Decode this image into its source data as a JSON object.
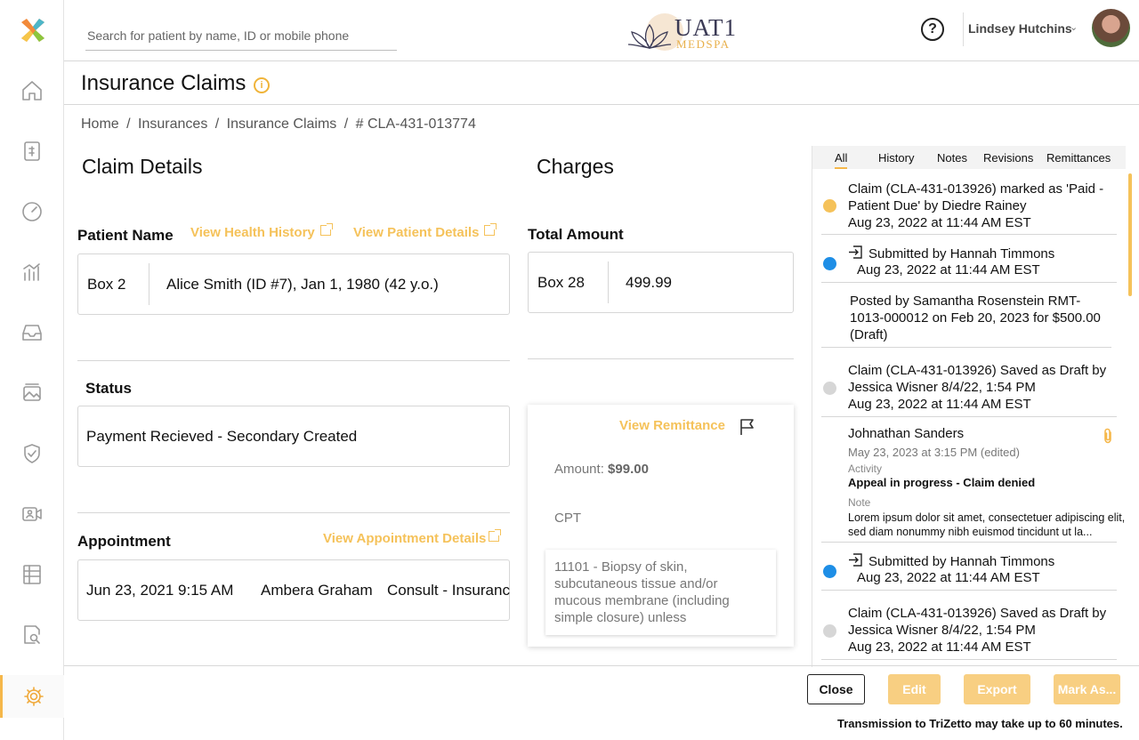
{
  "topbar": {
    "search_placeholder": "Search for patient by name, ID or mobile phone",
    "brand_name": "UAT1",
    "brand_sub": "MEDSPA",
    "help": "?",
    "user_name": "Lindsey Hutchins",
    "user_chevron": "⌄"
  },
  "sidebar": {
    "items": [
      "home-icon",
      "invoice-icon",
      "dashboard-gauge-icon",
      "analytics-icon",
      "inbox-icon",
      "gallery-icon",
      "shield-icon",
      "video-icon",
      "list-icon",
      "search-document-icon",
      "settings-icon"
    ],
    "active": "settings-icon"
  },
  "header": {
    "title": "Insurance Claims",
    "breadcrumb": [
      "Home",
      "/",
      "Insurances",
      "/",
      "Insurance Claims",
      "/",
      "# CLA-431-013774"
    ]
  },
  "claim": {
    "section_title": "Claim Details",
    "patient_label": "Patient Name",
    "view_health_history": "View Health History",
    "view_patient_details": "View Patient Details",
    "patient_box_key": "Box 2",
    "patient_value": "Alice Smith (ID #7), Jan 1, 1980 (42 y.o.)",
    "status_label": "Status",
    "status_value": "Payment Recieved - Secondary Created",
    "appointment_label": "Appointment",
    "view_appointment_details": "View Appointment Details",
    "appointment_date": "Jun 23, 2021 9:15 AM",
    "appointment_provider": "Ambera Graham",
    "appointment_type": "Consult - Insurance"
  },
  "charges": {
    "section_title": "Charges",
    "total_label": "Total Amount",
    "total_box_key": "Box 28",
    "total_value": "499.99",
    "remittance": {
      "link": "View Remittance",
      "amount_label": "Amount:",
      "amount_value": "$99.00",
      "cpt_label": "CPT",
      "cpt_desc": "11101 - Biopsy of skin, subcutaneous tissue and/or mucous membrane (including simple closure) unless"
    }
  },
  "panel": {
    "tabs": [
      "All",
      "History",
      "Notes",
      "Revisions",
      "Remittances"
    ],
    "active_tab": "All",
    "activities": [
      {
        "dot": "orange",
        "text": "Claim (CLA-431-013926) marked as 'Paid - Patient Due' by Diedre Rainey",
        "date": "Aug 23, 2022 at 11:44 AM EST"
      },
      {
        "dot": "blue",
        "text": "Submitted by Hannah Timmons",
        "date": "Aug 23, 2022 at 11:44 AM EST"
      },
      {
        "dot": "",
        "text": "Posted by Samantha Rosenstein RMT-1013-000012 on Feb 20, 2023 for $500.00 (Draft)",
        "date": ""
      },
      {
        "dot": "grey",
        "text": "Claim (CLA-431-013926) Saved as Draft by Jessica Wisner 8/4/22, 1:54 PM",
        "date": "Aug 23, 2022 at 11:44 AM EST"
      },
      {
        "dot": "blue",
        "text": "Submitted by Hannah Timmons",
        "date": "Aug 23, 2022 at 11:44 AM EST"
      },
      {
        "dot": "grey",
        "text": "Claim (CLA-431-013926) Saved as Draft by Jessica Wisner 8/4/22, 1:54 PM",
        "date": "Aug 23, 2022 at 11:44 AM EST"
      }
    ],
    "note": {
      "name": "Johnathan Sanders",
      "date": "May 23, 2023 at 3:15 PM (edited)",
      "activity_label": "Activity",
      "activity_value": "Appeal in progress - Claim denied",
      "note_label": "Note",
      "note_body": "Lorem ipsum dolor sit amet, consectetuer adipiscing elit, sed diam nonummy nibh euismod tincidunt ut la..."
    }
  },
  "footer": {
    "close": "Close",
    "edit": "Edit",
    "export": "Export",
    "mark_as": "Mark As...",
    "note": "Transmission to TriZetto may take up to 60 minutes."
  }
}
